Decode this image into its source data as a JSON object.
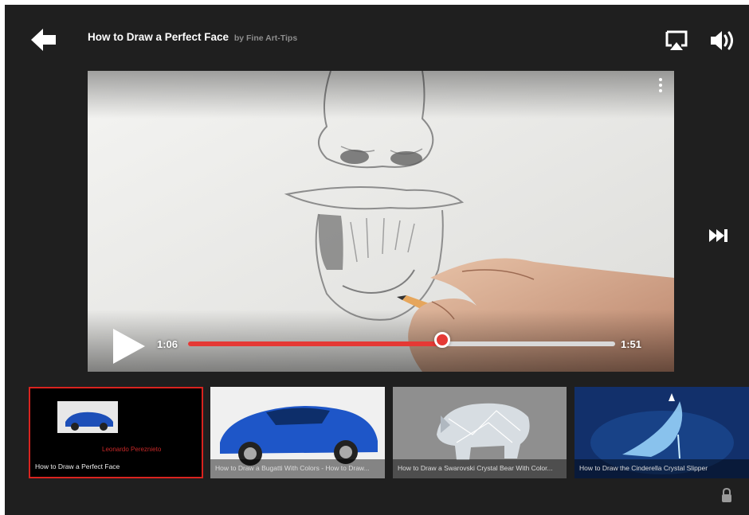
{
  "header": {
    "title": "How to Draw a Perfect Face",
    "author": "by Fine Art-Tips",
    "back_icon": "arrow-left-icon",
    "airplay_icon": "airplay-icon",
    "volume_icon": "volume-icon"
  },
  "player": {
    "current_time": "1:06",
    "total_time": "1:51",
    "progress": 0.5946,
    "accent_color": "#e53935",
    "play_icon": "play-icon",
    "more_icon": "more-vertical-icon",
    "next_icon": "skip-next-icon"
  },
  "playlist": [
    {
      "title": "How to Draw a Perfect Face",
      "overlay_text": "Leonardo Pereznieto",
      "active": true
    },
    {
      "title": "How to Draw a Bugatti With Colors - How to Draw...",
      "active": false
    },
    {
      "title": "How to Draw a Swarovski Crystal Bear With Color...",
      "active": false
    },
    {
      "title": "How to Draw the Cinderella Crystal Slipper",
      "active": false
    }
  ],
  "lock_icon": "lock-icon"
}
